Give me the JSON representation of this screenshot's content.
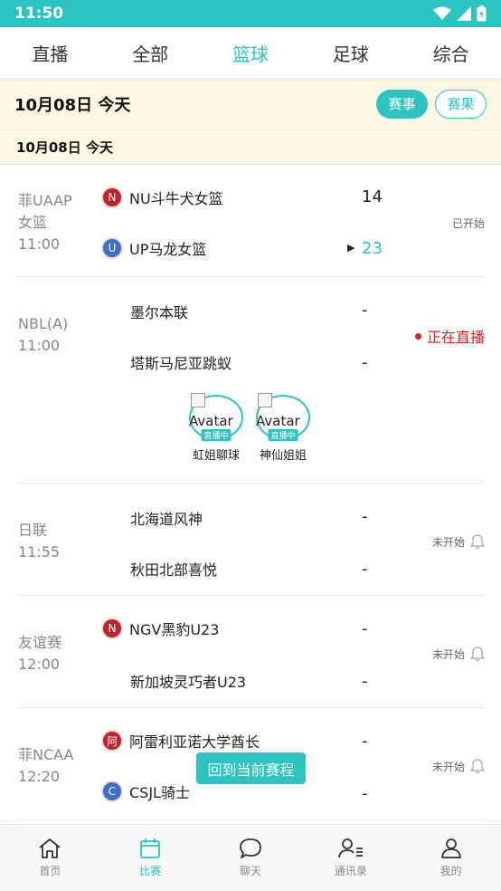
{
  "status_bar": {
    "time": "11:50"
  },
  "tabs": [
    "直播",
    "全部",
    "篮球",
    "足球",
    "综合"
  ],
  "active_tab": 2,
  "date_bar": {
    "date": "10月08日  今天",
    "btn_events": "赛事",
    "btn_results": "赛果"
  },
  "sub_date": "10月08日   今天",
  "matches": [
    {
      "league": "菲UAAP\n女篮",
      "time": "11:00",
      "home": {
        "name": "NU斗牛犬女篮",
        "badge": "N",
        "badge_color": "red",
        "score": "14"
      },
      "away": {
        "name": "UP马龙女篮",
        "badge": "U",
        "badge_color": "blue",
        "score": "23"
      },
      "status": "已开始"
    },
    {
      "league": "NBL(A)",
      "time": "11:00",
      "home": {
        "name": "墨尔本联",
        "score": "-"
      },
      "away": {
        "name": "塔斯马尼亚跳蚁",
        "score": "-"
      },
      "status": "正在直播",
      "anchors": [
        {
          "alt": "Avatar",
          "tag": "直播中",
          "name": "虹姐聊球"
        },
        {
          "alt": "Avatar",
          "tag": "直播中",
          "name": "神仙姐姐"
        }
      ]
    },
    {
      "league": "日联",
      "time": "11:55",
      "home": {
        "name": "北海道风神",
        "score": "-"
      },
      "away": {
        "name": "秋田北部喜悦",
        "score": "-"
      },
      "status": "未开始"
    },
    {
      "league": "友谊赛",
      "time": "12:00",
      "home": {
        "name": "NGV黑豹U23",
        "badge": "N",
        "badge_color": "red",
        "score": "-"
      },
      "away": {
        "name": "新加坡灵巧者U23",
        "score": "-"
      },
      "status": "未开始"
    },
    {
      "league": "菲NCAA",
      "time": "12:20",
      "home": {
        "name": "阿雷利亚诺大学酋长",
        "badge": "阿",
        "badge_color": "red",
        "score": "-"
      },
      "away": {
        "name": "CSJL骑士",
        "badge": "C",
        "badge_color": "blue",
        "score": "-"
      },
      "status": "未开始"
    }
  ],
  "float_button": "回到当前赛程",
  "bottom_nav": [
    {
      "label": "首页",
      "icon": "home-icon"
    },
    {
      "label": "比赛",
      "icon": "calendar-icon"
    },
    {
      "label": "聊天",
      "icon": "chat-icon"
    },
    {
      "label": "通讯录",
      "icon": "contacts-icon"
    },
    {
      "label": "我的",
      "icon": "profile-icon"
    }
  ],
  "active_nav": 1,
  "colors": {
    "accent": "#2bc4c0",
    "live": "#e0201c",
    "date_bg": "#fdf8e4"
  }
}
